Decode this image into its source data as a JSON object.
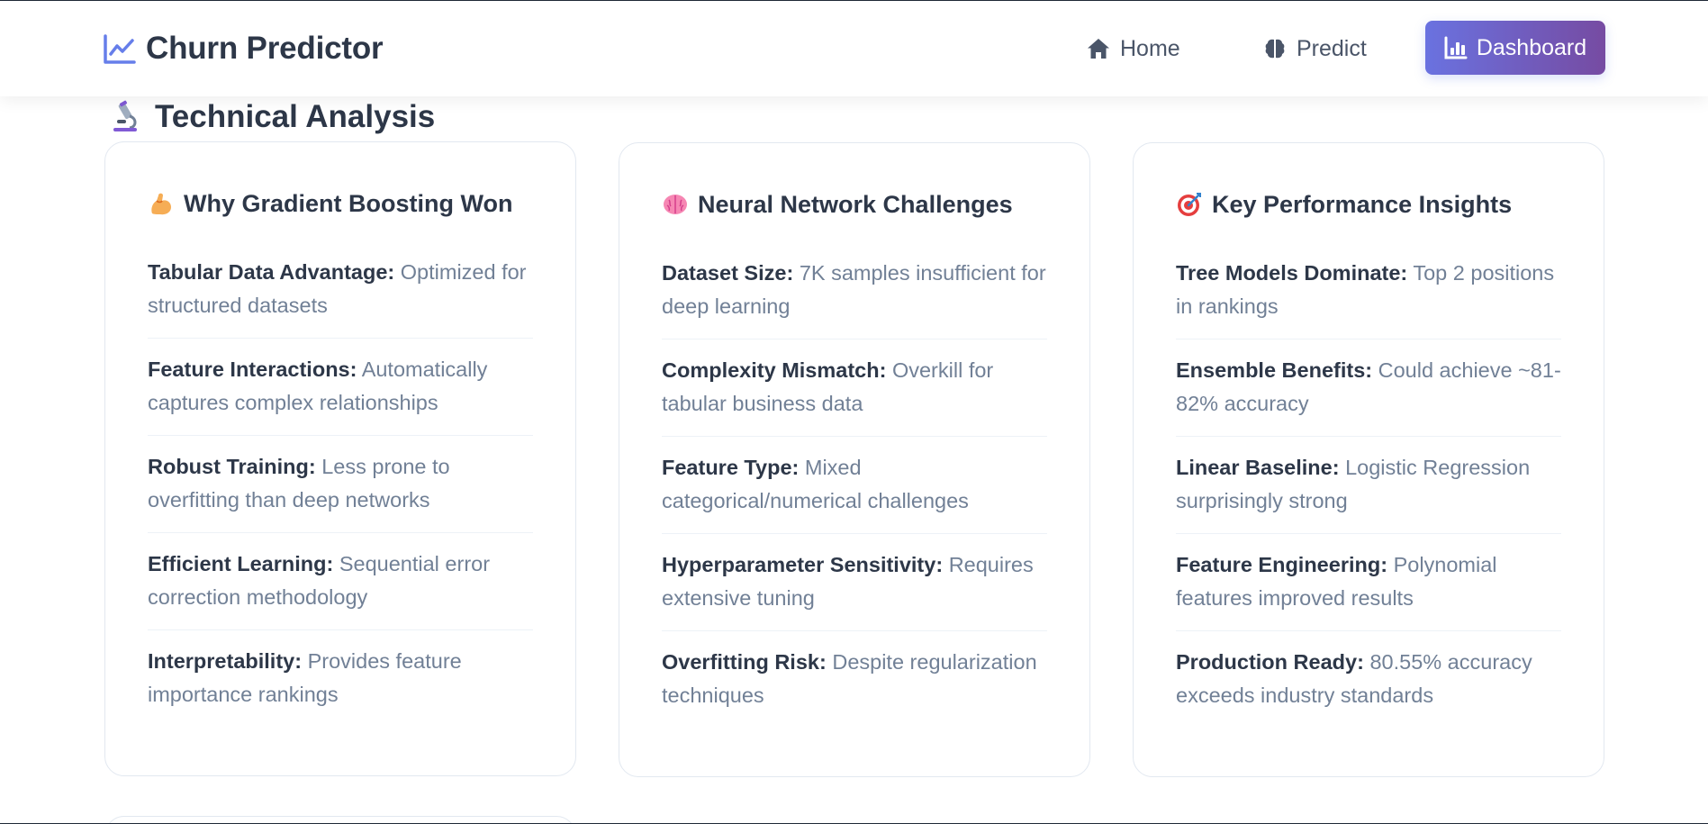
{
  "nav": {
    "brand": "Churn Predictor",
    "links": [
      {
        "label": "Home",
        "icon": "home-icon"
      },
      {
        "label": "Predict",
        "icon": "brain-icon"
      },
      {
        "label": "Dashboard",
        "icon": "bar-chart-icon",
        "active": true
      }
    ]
  },
  "section": {
    "title": "Technical Analysis",
    "icon": "microscope-icon"
  },
  "cards": [
    {
      "title": "Why Gradient Boosting Won",
      "icon": "flexed-bicep-icon",
      "items": [
        {
          "label": "Tabular Data Advantage:",
          "text": "Optimized for structured datasets"
        },
        {
          "label": "Feature Interactions:",
          "text": "Automatically captures complex relationships"
        },
        {
          "label": "Robust Training:",
          "text": "Less prone to overfitting than deep networks"
        },
        {
          "label": "Efficient Learning:",
          "text": "Sequential error correction methodology"
        },
        {
          "label": "Interpretability:",
          "text": "Provides feature importance rankings"
        }
      ]
    },
    {
      "title": "Neural Network Challenges",
      "icon": "brain-icon",
      "items": [
        {
          "label": "Dataset Size:",
          "text": "7K samples insufficient for deep learning"
        },
        {
          "label": "Complexity Mismatch:",
          "text": "Overkill for tabular business data"
        },
        {
          "label": "Feature Type:",
          "text": "Mixed categorical/numerical challenges"
        },
        {
          "label": "Hyperparameter Sensitivity:",
          "text": "Requires extensive tuning"
        },
        {
          "label": "Overfitting Risk:",
          "text": "Despite regularization techniques"
        }
      ]
    },
    {
      "title": "Key Performance Insights",
      "icon": "target-icon",
      "items": [
        {
          "label": "Tree Models Dominate:",
          "text": "Top 2 positions in rankings"
        },
        {
          "label": "Ensemble Benefits:",
          "text": "Could achieve ~81-82% accuracy"
        },
        {
          "label": "Linear Baseline:",
          "text": "Logistic Regression surprisingly strong"
        },
        {
          "label": "Feature Engineering:",
          "text": "Polynomial features improved results"
        },
        {
          "label": "Production Ready:",
          "text": "80.55% accuracy exceeds industry standards"
        }
      ]
    }
  ],
  "colors": {
    "accent_start": "#6a72e0",
    "accent_end": "#764ba2",
    "heading": "#2d3748",
    "muted_text": "#718096",
    "card_border": "#e2e8f0"
  }
}
